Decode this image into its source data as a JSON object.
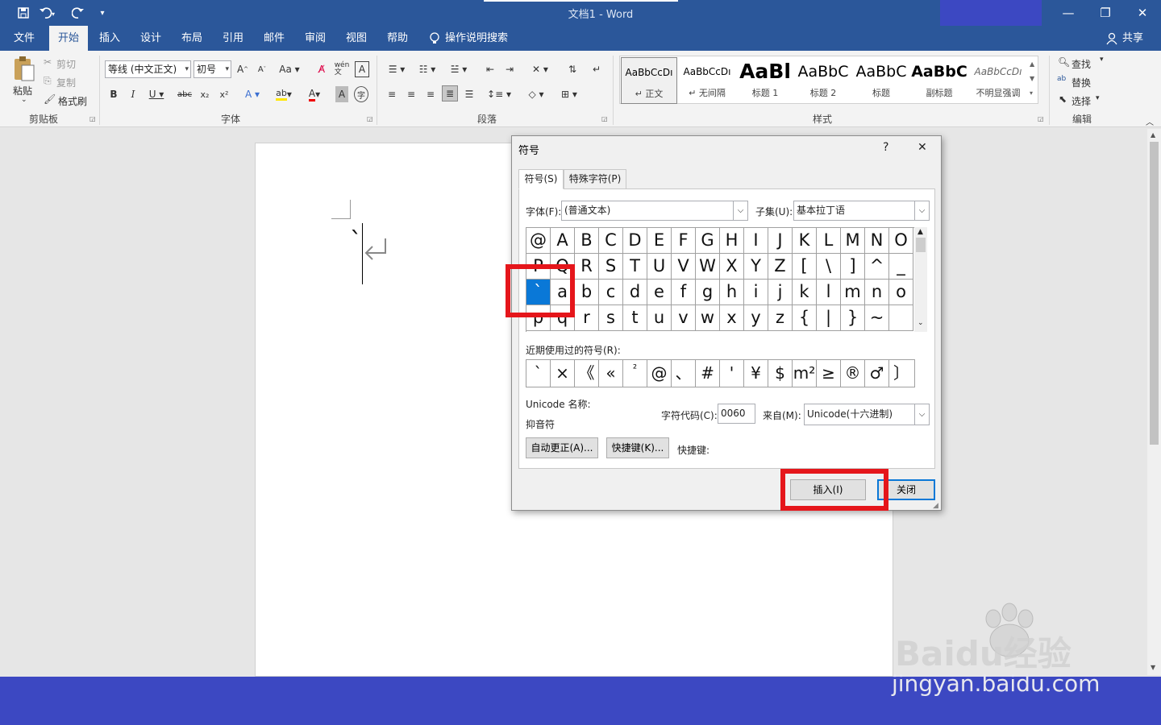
{
  "title_bar": {
    "doc_title": "文档1  -  Word"
  },
  "ribbon_tabs": [
    "文件",
    "开始",
    "插入",
    "设计",
    "布局",
    "引用",
    "邮件",
    "审阅",
    "视图",
    "帮助"
  ],
  "tell_me": "操作说明搜索",
  "share": "共享",
  "clipboard": {
    "paste": "粘贴",
    "cut": "剪切",
    "copy": "复制",
    "format_painter": "格式刷",
    "group": "剪贴板"
  },
  "font": {
    "name": "等线 (中文正文)",
    "size": "初号",
    "group": "字体"
  },
  "paragraph": {
    "group": "段落"
  },
  "styles": {
    "group": "样式",
    "items": [
      {
        "preview": "AaBbCcDı",
        "name": "↵ 正文"
      },
      {
        "preview": "AaBbCcDı",
        "name": "↵ 无间隔"
      },
      {
        "preview": "AaBl",
        "name": "标题 1"
      },
      {
        "preview": "AaBbC",
        "name": "标题 2"
      },
      {
        "preview": "AaBbC",
        "name": "标题"
      },
      {
        "preview": "AaBbC",
        "name": "副标题"
      },
      {
        "preview": "AaBbCcDı",
        "name": "不明显强调"
      }
    ]
  },
  "editing": {
    "find": "查找",
    "replace": "替换",
    "select": "选择",
    "group": "编辑"
  },
  "document": {
    "char": "`"
  },
  "dialog": {
    "title": "符号",
    "help": "?",
    "close_x": "✕",
    "tabs": [
      "符号(S)",
      "特殊字符(P)"
    ],
    "font_label": "字体(F):",
    "font_value": "(普通文本)",
    "subset_label": "子集(U):",
    "subset_value": "基本拉丁语",
    "grid": [
      [
        "@",
        "A",
        "B",
        "C",
        "D",
        "E",
        "F",
        "G",
        "H",
        "I",
        "J",
        "K",
        "L",
        "M",
        "N",
        "O"
      ],
      [
        "P",
        "Q",
        "R",
        "S",
        "T",
        "U",
        "V",
        "W",
        "X",
        "Y",
        "Z",
        "[",
        "\\",
        "]",
        "^",
        "_"
      ],
      [
        "`",
        "a",
        "b",
        "c",
        "d",
        "e",
        "f",
        "g",
        "h",
        "i",
        "j",
        "k",
        "l",
        "m",
        "n",
        "o"
      ],
      [
        "p",
        "q",
        "r",
        "s",
        "t",
        "u",
        "v",
        "w",
        "x",
        "y",
        "z",
        "{",
        "|",
        "}",
        "~",
        ""
      ]
    ],
    "recent_label": "近期使用过的符号(R):",
    "recent": [
      "`",
      "×",
      "《",
      "«",
      "²",
      "@",
      "、",
      "#",
      "'",
      "¥",
      "$",
      "m²",
      "≥",
      "®",
      "♂",
      "〕"
    ],
    "unicode_name_label": "Unicode 名称:",
    "unicode_name": "抑音符",
    "char_code_label": "字符代码(C):",
    "char_code": "0060",
    "from_label": "来自(M):",
    "from_value": "Unicode(十六进制)",
    "autocorrect": "自动更正(A)...",
    "shortcut_key_btn": "快捷键(K)...",
    "shortcut_label": "快捷键:",
    "insert": "插入(I)",
    "close": "关闭"
  },
  "watermark": {
    "logo": "Baidu经验",
    "url": "jingyan.baidu.com"
  }
}
